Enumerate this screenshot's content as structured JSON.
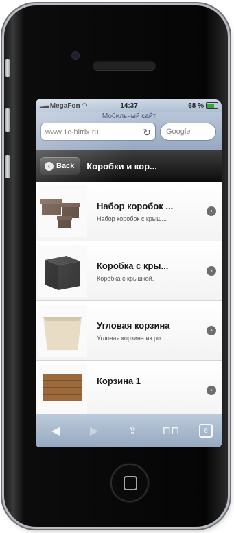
{
  "status_bar": {
    "carrier": "MegaFon",
    "time": "14:37",
    "battery": "68 %",
    "battery_level": 0.68
  },
  "browser": {
    "page_title": "Мобильный сайт",
    "url": "www.1c-bitrix.ru",
    "search_placeholder": "Google"
  },
  "app_bar": {
    "back_label": "Back",
    "title": "Коробки и кор..."
  },
  "items": [
    {
      "name": "Набор коробок ...",
      "description": "Набор коробок с крыш..."
    },
    {
      "name": "Коробка с кры...",
      "description": "Коробка с крышкой."
    },
    {
      "name": "Угловая корзина",
      "description": "Угловая корзина из ро..."
    },
    {
      "name": "Корзина 1",
      "description": ""
    }
  ],
  "toolbar": {
    "icons": [
      "back-arrow-icon",
      "forward-arrow-icon",
      "share-icon",
      "bookmarks-icon",
      "tabs-icon"
    ],
    "tabs_count": "6"
  },
  "colors": {
    "ios_bar": "#aebfd3",
    "app_bar": "#1a1a1a",
    "battery_fill": "#33aa33"
  }
}
